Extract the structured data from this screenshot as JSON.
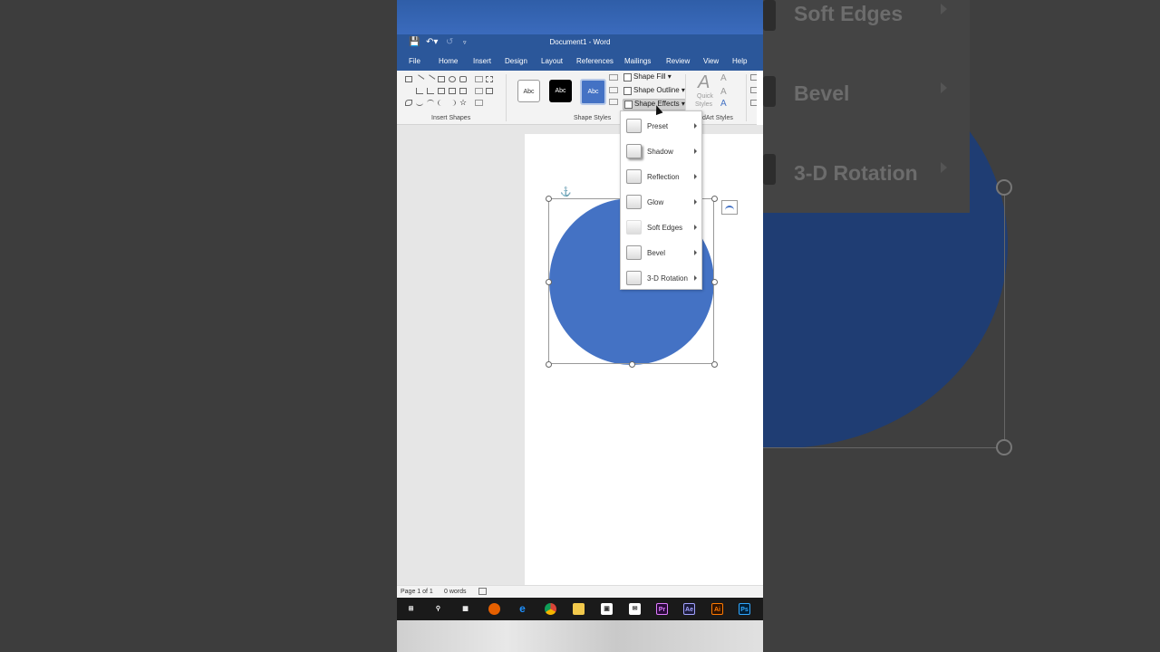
{
  "background_right": {
    "items": [
      "Soft Edges",
      "Bevel",
      "3-D Rotation"
    ]
  },
  "titlebar": {
    "title": "Document1  -  Word",
    "save_icon": "save-icon",
    "undo_icon": "undo-icon",
    "redo_icon": "redo-icon",
    "customize_icon": "customize-qat-icon"
  },
  "tabs": [
    "File",
    "Home",
    "Insert",
    "Design",
    "Layout",
    "References",
    "Mailings",
    "Review",
    "View",
    "Help"
  ],
  "ribbon": {
    "insert_shapes_label": "Insert Shapes",
    "shape_styles_label": "Shape Styles",
    "wordart_styles_label": "dArt Styles",
    "style_sample": "Abc",
    "shape_fill": "Shape Fill",
    "shape_outline": "Shape Outline",
    "shape_effects": "Shape Effects",
    "quick_styles_line1": "Quick",
    "quick_styles_line2": "Styles"
  },
  "dropdown": {
    "items": [
      "Preset",
      "Shadow",
      "Reflection",
      "Glow",
      "Soft Edges",
      "Bevel",
      "3-D Rotation"
    ]
  },
  "status": {
    "page": "Page 1 of 1",
    "words": "0 words"
  },
  "taskbar": {
    "icons": [
      "windows-icon",
      "search-icon",
      "task-view-icon",
      "firefox-icon",
      "edge-icon",
      "chrome-icon",
      "file-explorer-icon",
      "store-icon",
      "mail-icon",
      "premiere-icon",
      "after-effects-icon",
      "illustrator-icon",
      "photoshop-icon"
    ],
    "labels": {
      "premiere": "Pr",
      "after_effects": "Ae",
      "illustrator": "Ai",
      "photoshop": "Ps"
    }
  },
  "colors": {
    "word_blue": "#2b579a",
    "shape_fill": "#4472c4"
  }
}
